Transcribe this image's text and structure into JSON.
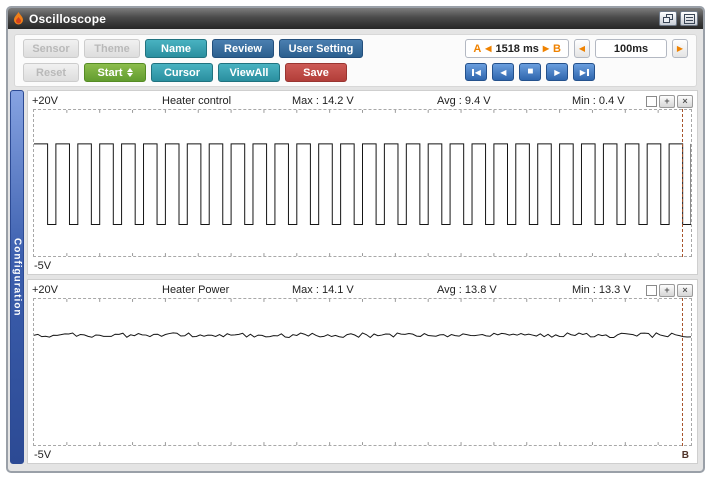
{
  "window": {
    "title": "Oscilloscope"
  },
  "icons": {
    "left_triangle": "◀",
    "right_triangle": "▶",
    "stop_square": "■",
    "close": "×",
    "zoom_plus": "+"
  },
  "toolbar": {
    "row1": [
      {
        "label": "Sensor",
        "state": "disabled"
      },
      {
        "label": "Theme",
        "state": "disabled"
      },
      {
        "label": "Name",
        "state": "teal"
      },
      {
        "label": "Review",
        "state": "blue"
      },
      {
        "label": "User Setting",
        "state": "blue"
      }
    ],
    "row2": [
      {
        "label": "Reset",
        "state": "disabled"
      },
      {
        "label": "Start",
        "state": "green"
      },
      {
        "label": "Cursor",
        "state": "teal"
      },
      {
        "label": "ViewAll",
        "state": "teal"
      },
      {
        "label": "Save",
        "state": "red"
      }
    ],
    "range": {
      "a": "A",
      "value": "1518 ms",
      "b": "B"
    },
    "timebase": "100ms"
  },
  "sidebar": {
    "label": "Configuration"
  },
  "panels": [
    {
      "v_top": "+20V",
      "v_bottom": "-5V",
      "name": "Heater control",
      "max": "Max : 14.2 V",
      "avg": "Avg : 9.4 V",
      "min": "Min : 0.4 V",
      "cursor_label": ""
    },
    {
      "v_top": "+20V",
      "v_bottom": "-5V",
      "name": "Heater Power",
      "max": "Max : 14.1 V",
      "avg": "Avg : 13.8 V",
      "min": "Min : 13.3 V",
      "cursor_label": "B"
    }
  ],
  "chart_data": [
    {
      "type": "line",
      "title": "Heater control",
      "waveform": "square",
      "v_high": 14.2,
      "v_low": 0.4,
      "v_avg": 9.4,
      "periods": 30,
      "duty_high": 0.62,
      "ylim": [
        -5,
        20
      ],
      "x_window": "1518 ms",
      "timebase": "100ms"
    },
    {
      "type": "line",
      "title": "Heater Power",
      "waveform": "noisy-dc",
      "v_level": 13.8,
      "v_min": 13.3,
      "v_max": 14.1,
      "ylim": [
        -5,
        20
      ],
      "x_window": "1518 ms",
      "timebase": "100ms"
    }
  ],
  "colors": {
    "teal": "#2a8f9f",
    "blue": "#2c5f8e",
    "green": "#629c2f",
    "red": "#b23e39",
    "orange": "#ef8200",
    "sidebar_blue": "#3c5fae",
    "cursor_line": "#a8542c",
    "trace": "#151515"
  }
}
